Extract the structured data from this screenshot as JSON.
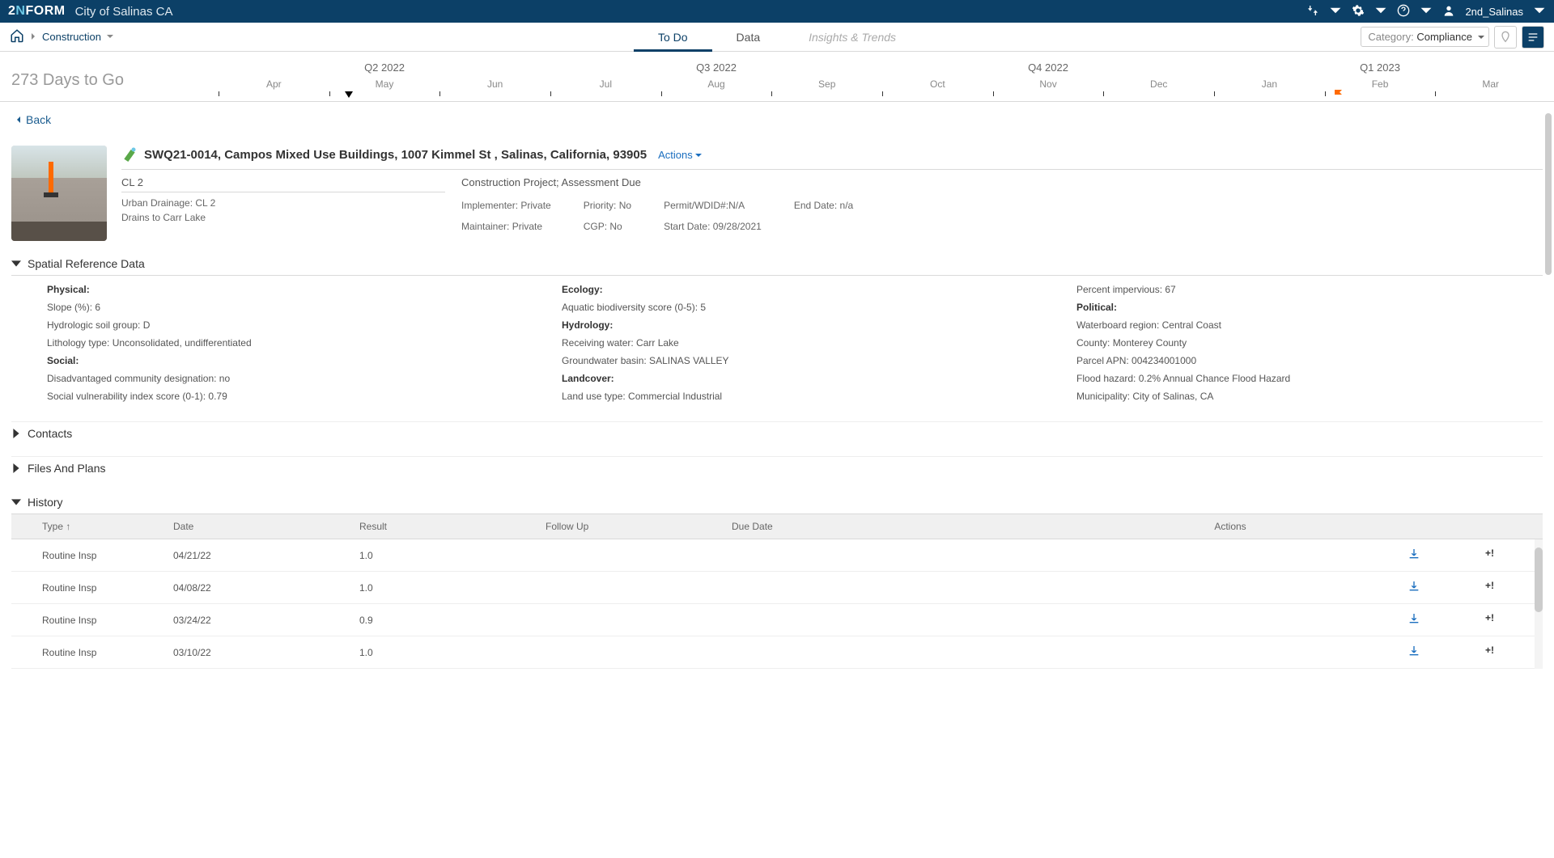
{
  "topbar": {
    "logo_prefix": "2",
    "logo_mid": "N",
    "logo_suffix": "FORM",
    "city": "City of Salinas CA",
    "user": "2nd_Salinas"
  },
  "subnav": {
    "breadcrumb": "Construction",
    "tabs": {
      "todo": "To Do",
      "data": "Data",
      "insights": "Insights & Trends"
    },
    "category_label": "Category:",
    "category_value": "Compliance"
  },
  "timeline": {
    "days_to_go": "273 Days to Go",
    "quarters": [
      "Q2 2022",
      "Q3 2022",
      "Q4 2022",
      "Q1 2023"
    ],
    "months": [
      "Apr",
      "May",
      "Jun",
      "Jul",
      "Aug",
      "Sep",
      "Oct",
      "Nov",
      "Dec",
      "Jan",
      "Feb",
      "Mar"
    ]
  },
  "back_label": "Back",
  "project": {
    "title": "SWQ21-0014, Campos Mixed Use Buildings, 1007 Kimmel St , Salinas, California, 93905",
    "actions": "Actions",
    "cl": "CL 2",
    "status": "Construction Project; Assessment Due",
    "urban_drainage": "Urban Drainage: CL 2",
    "drains_to": "Drains to Carr Lake",
    "implementer": "Implementer: Private",
    "maintainer": "Maintainer: Private",
    "priority": "Priority: No",
    "cgp": "CGP: No",
    "permit": "Permit/WDID#:N/A",
    "start_date": "Start Date: 09/28/2021",
    "end_date": "End Date: n/a"
  },
  "sections": {
    "spatial": "Spatial Reference Data",
    "contacts": "Contacts",
    "files": "Files And Plans",
    "history": "History"
  },
  "srd": {
    "physical": "Physical:",
    "slope": "Slope (%): 6",
    "soil": "Hydrologic soil group: D",
    "lith": "Lithology type: Unconsolidated, undifferentiated",
    "social": "Social:",
    "dac": "Disadvantaged community designation: no",
    "svi": "Social vulnerability index score (0-1): 0.79",
    "ecology": "Ecology:",
    "biodiv": "Aquatic biodiversity score (0-5): 5",
    "hydrology": "Hydrology:",
    "recv": "Receiving water: Carr Lake",
    "gwb": "Groundwater basin: SALINAS VALLEY",
    "landcover": "Landcover:",
    "landuse": "Land use type: Commercial Industrial",
    "imperv": "Percent impervious: 67",
    "political": "Political:",
    "wbr": "Waterboard region: Central Coast",
    "county": "County: Monterey County",
    "apn": "Parcel APN: 004234001000",
    "flood": "Flood hazard: 0.2% Annual Chance Flood Hazard",
    "muni": "Municipality: City of Salinas, CA"
  },
  "history_header": {
    "type": "Type",
    "date": "Date",
    "result": "Result",
    "follow": "Follow Up",
    "due": "Due Date",
    "actions": "Actions"
  },
  "history": [
    {
      "type": "Routine Insp",
      "date": "04/21/22",
      "result": "1.0",
      "escalate": "+!"
    },
    {
      "type": "Routine Insp",
      "date": "04/08/22",
      "result": "1.0",
      "escalate": "+!"
    },
    {
      "type": "Routine Insp",
      "date": "03/24/22",
      "result": "0.9",
      "escalate": "+!"
    },
    {
      "type": "Routine Insp",
      "date": "03/10/22",
      "result": "1.0",
      "escalate": "+!"
    }
  ]
}
